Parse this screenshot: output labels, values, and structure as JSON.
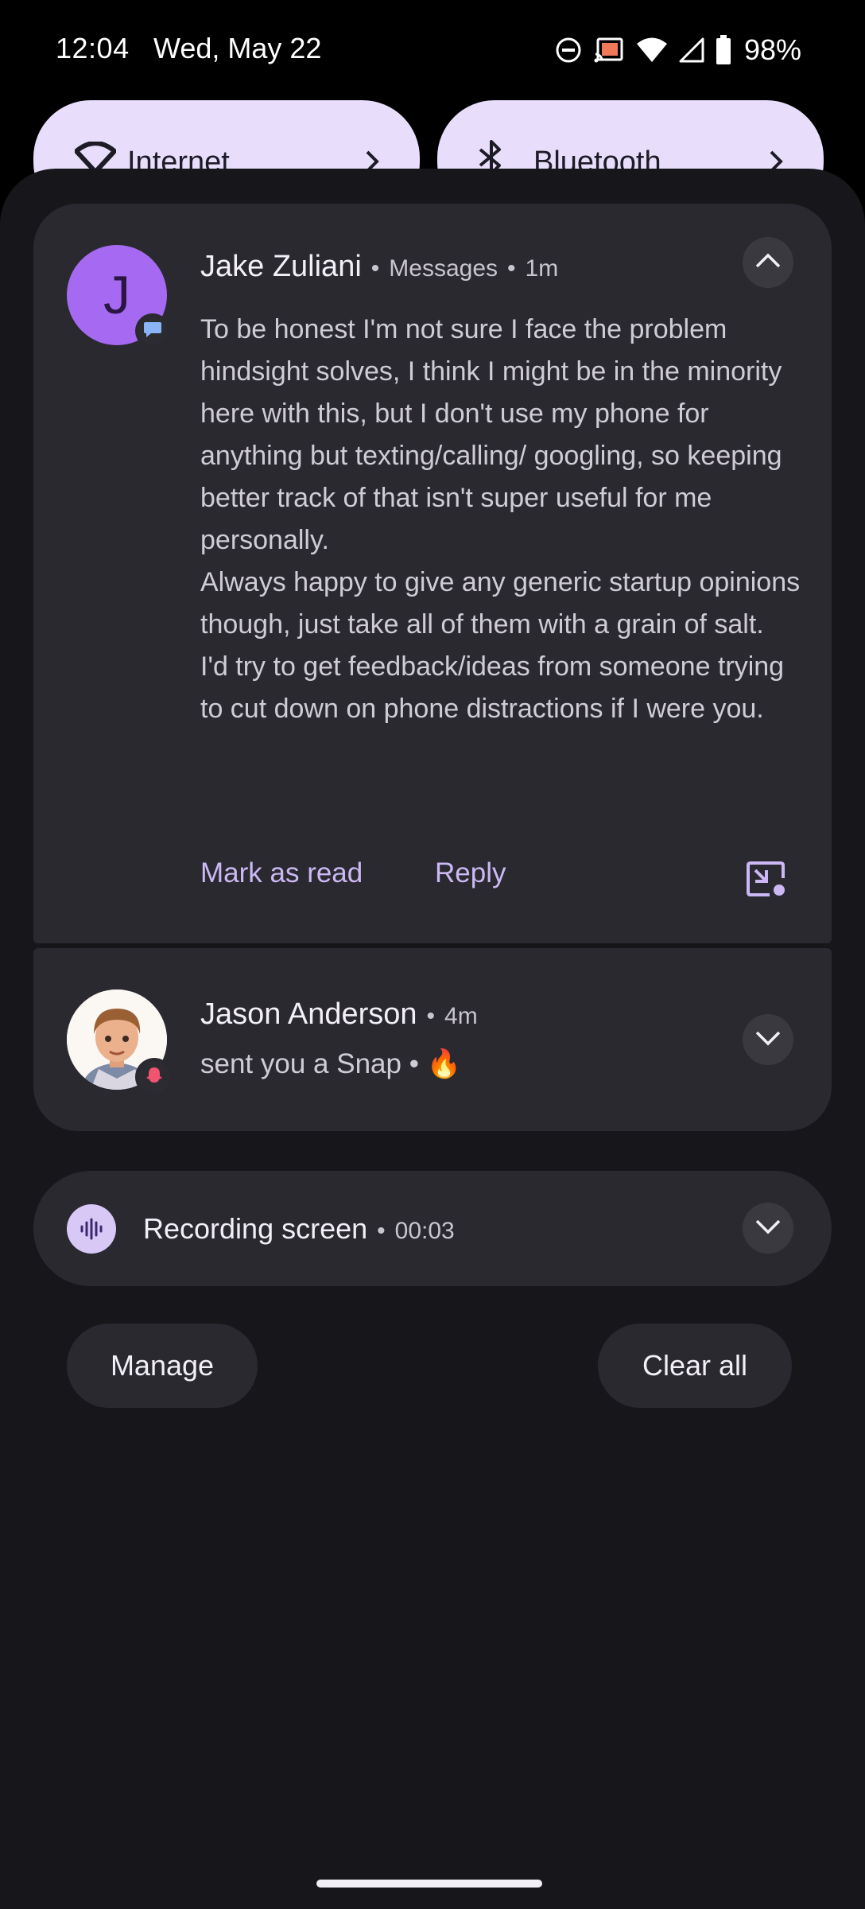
{
  "status_bar": {
    "time": "12:04",
    "date": "Wed, May 22",
    "battery": "98%",
    "icons": [
      "do-not-disturb-icon",
      "cast-icon",
      "wifi-icon",
      "cellular-signal-icon",
      "battery-icon"
    ]
  },
  "quick_settings": {
    "tiles": [
      {
        "label": "Internet",
        "icon": "wifi-icon"
      },
      {
        "label": "Bluetooth",
        "icon": "bluetooth-icon"
      }
    ]
  },
  "notifications": [
    {
      "avatar_letter": "J",
      "title": "Jake Zuliani",
      "app": "Messages",
      "time": "1m",
      "badge_icon": "chat-bubble-icon",
      "paragraphs": [
        "To be honest I'm not sure I face the problem hindsight solves, I think I might be in the minority here with this, but I don't use my phone for anything but texting/calling/ googling, so keeping better track of that isn't super useful for me personally.",
        "Always happy to give any generic startup opinions though, just take all of them with a grain of salt.",
        "I'd try to get feedback/ideas from someone trying to cut down on phone distractions if I were you."
      ],
      "actions": [
        "Mark as read",
        "Reply"
      ],
      "expanded": true
    },
    {
      "title": "Jason Anderson",
      "time": "4m",
      "body": "sent you a Snap • 🔥",
      "badge_icon": "snapchat-ghost-icon",
      "expanded": false
    }
  ],
  "recording": {
    "title": "Recording screen",
    "elapsed": "00:03",
    "icon": "sound-wave-icon"
  },
  "buttons": {
    "manage": "Manage",
    "clear_all": "Clear all"
  },
  "colors": {
    "shade_bg": "#16161b",
    "card_bg": "#2a2930",
    "accent": "#cbb8f4",
    "avatar_purple": "#a66af2",
    "tile_bg": "#e8defb"
  }
}
